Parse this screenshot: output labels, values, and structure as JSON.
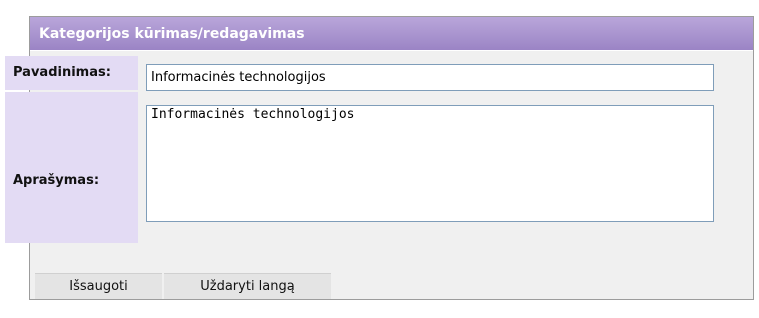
{
  "panel": {
    "title": "Kategorijos kūrimas/redagavimas",
    "header_color": "#a08bc8",
    "label_bg_color": "#e3dbf4"
  },
  "form": {
    "name_label": "Pavadinimas:",
    "name_value": "Informacinės technologijos",
    "description_label": "Aprašymas:",
    "description_value": "Informacinės technologijos"
  },
  "buttons": {
    "save_label": "Išsaugoti",
    "close_label": "Uždaryti langą"
  }
}
